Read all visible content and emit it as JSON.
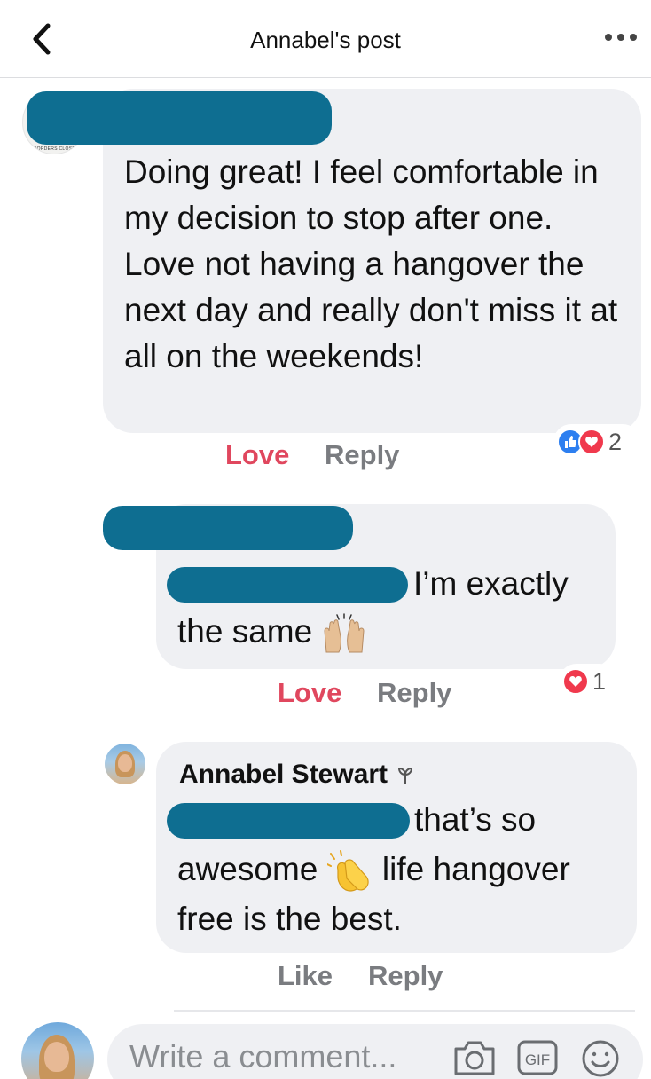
{
  "header": {
    "title": "Annabel's post",
    "back_icon": "chevron-left-icon",
    "more_icon": "more-dots-icon"
  },
  "comments": [
    {
      "avatar_caption": "BORDERS CLOSED",
      "text": "Doing great! I feel comfortable in my decision to stop after one. Love not having a hangover the next day and really don't miss it at all on the weekends!",
      "actions": {
        "love": "Love",
        "reply": "Reply"
      },
      "reaction_count": "2",
      "reaction_icons": [
        "like-reaction-icon",
        "heart-reaction-icon"
      ]
    },
    {
      "text_a": "I’m exactly",
      "text_b": "the same",
      "emoji": "raised-hands-emoji",
      "actions": {
        "love": "Love",
        "reply": "Reply"
      },
      "reaction_count": "1",
      "reaction_icons": [
        "heart-reaction-icon"
      ]
    },
    {
      "author": "Annabel Stewart",
      "author_badge": "plant-sprout-icon",
      "text_a": "that’s so",
      "text_b1": "awesome",
      "emoji": "clapping-hands-emoji",
      "text_b2": "life hangover",
      "text_c": "free is the best.",
      "actions": {
        "like": "Like",
        "reply": "Reply"
      }
    }
  ],
  "composer": {
    "placeholder": "Write a comment...",
    "icons": [
      "camera-icon",
      "gif-icon",
      "emoji-smiley-icon"
    ]
  },
  "colors": {
    "love": "#e0475e",
    "action_gray": "#7a7c80",
    "bubble": "#eff0f3",
    "redaction": "#0e6e91",
    "like_blue": "#2d7ff0",
    "heart_red": "#f0394d"
  }
}
